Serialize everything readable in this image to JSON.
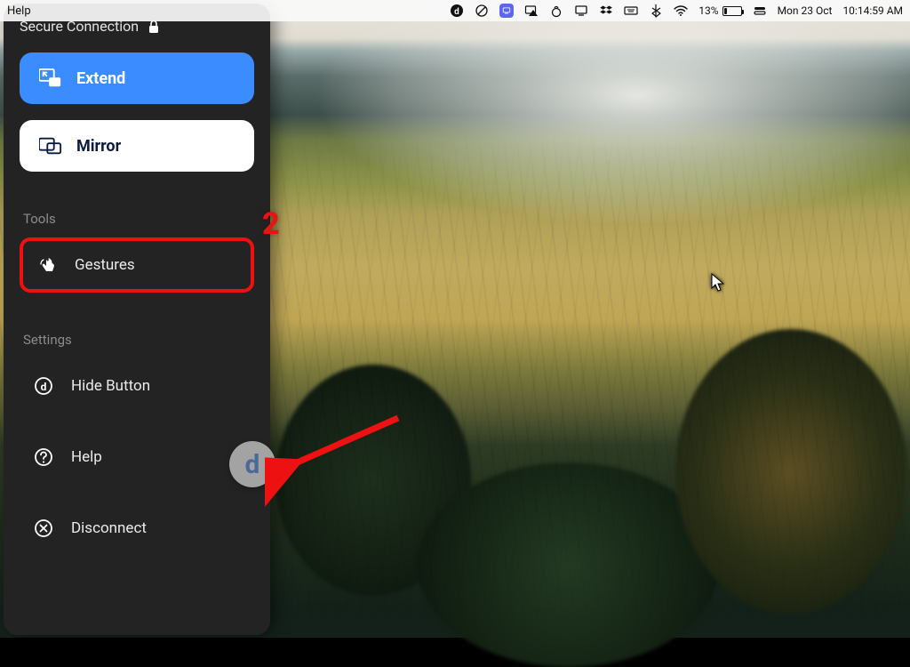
{
  "menubar": {
    "help_label": "Help",
    "battery_percent": "13%",
    "date": "Mon 23 Oct",
    "time": "10:14:59 AM"
  },
  "panel": {
    "secure_label": "Secure Connection",
    "mode_extend_label": "Extend",
    "mode_mirror_label": "Mirror",
    "tools_heading": "Tools",
    "gestures_label": "Gestures",
    "settings_heading": "Settings",
    "hide_button_label": "Hide Button",
    "help_label": "Help",
    "disconnect_label": "Disconnect"
  },
  "annotation": {
    "step_number": "2",
    "badge_letter": "d"
  }
}
